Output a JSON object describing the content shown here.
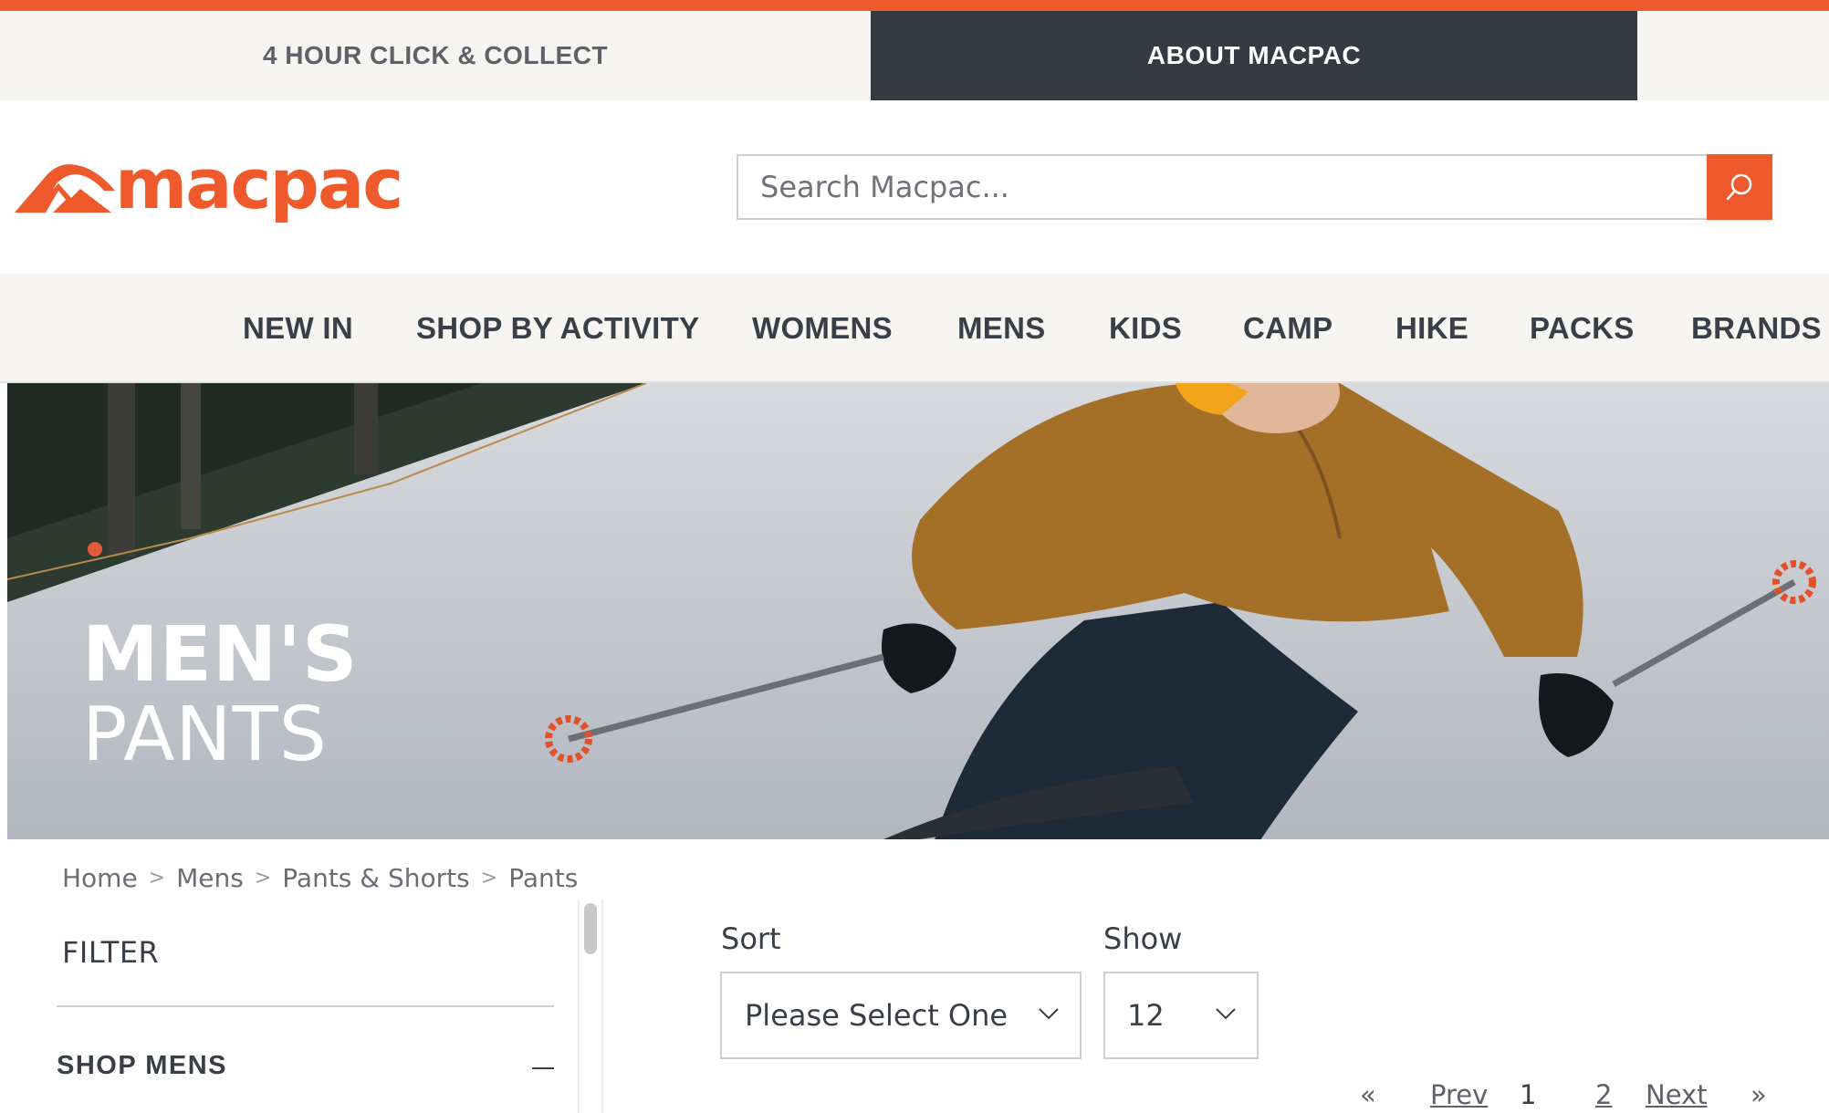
{
  "colors": {
    "brand": "#ee5a2b",
    "dark": "#363b43",
    "text": "#3a3f47",
    "bg_light": "#f7f5f2"
  },
  "promo": {
    "tabs": [
      {
        "label": "4 HOUR CLICK & COLLECT"
      },
      {
        "label": "ABOUT MACPAC"
      }
    ]
  },
  "header": {
    "logo_text": "macpac",
    "search": {
      "placeholder": "Search Macpac...",
      "value": "",
      "icon": "search-icon"
    }
  },
  "nav": {
    "items": [
      {
        "label": "NEW IN"
      },
      {
        "label": "SHOP BY ACTIVITY"
      },
      {
        "label": "WOMENS"
      },
      {
        "label": "MENS"
      },
      {
        "label": "KIDS"
      },
      {
        "label": "CAMP"
      },
      {
        "label": "HIKE"
      },
      {
        "label": "PACKS"
      },
      {
        "label": "BRANDS"
      }
    ]
  },
  "hero": {
    "title_line1": "MEN'S",
    "title_line2": "PANTS"
  },
  "breadcrumb": {
    "items": [
      {
        "label": "Home"
      },
      {
        "label": "Mens"
      },
      {
        "label": "Pants & Shorts"
      },
      {
        "label": "Pants"
      }
    ],
    "separator": ">"
  },
  "filter": {
    "title": "FILTER",
    "section": "SHOP MENS"
  },
  "controls": {
    "sort": {
      "label": "Sort",
      "value": "Please Select One"
    },
    "show": {
      "label": "Show",
      "value": "12"
    }
  },
  "pagination": {
    "first": "«",
    "prev": "Prev",
    "current": "1",
    "page2": "2",
    "next": "Next",
    "last": "»"
  }
}
